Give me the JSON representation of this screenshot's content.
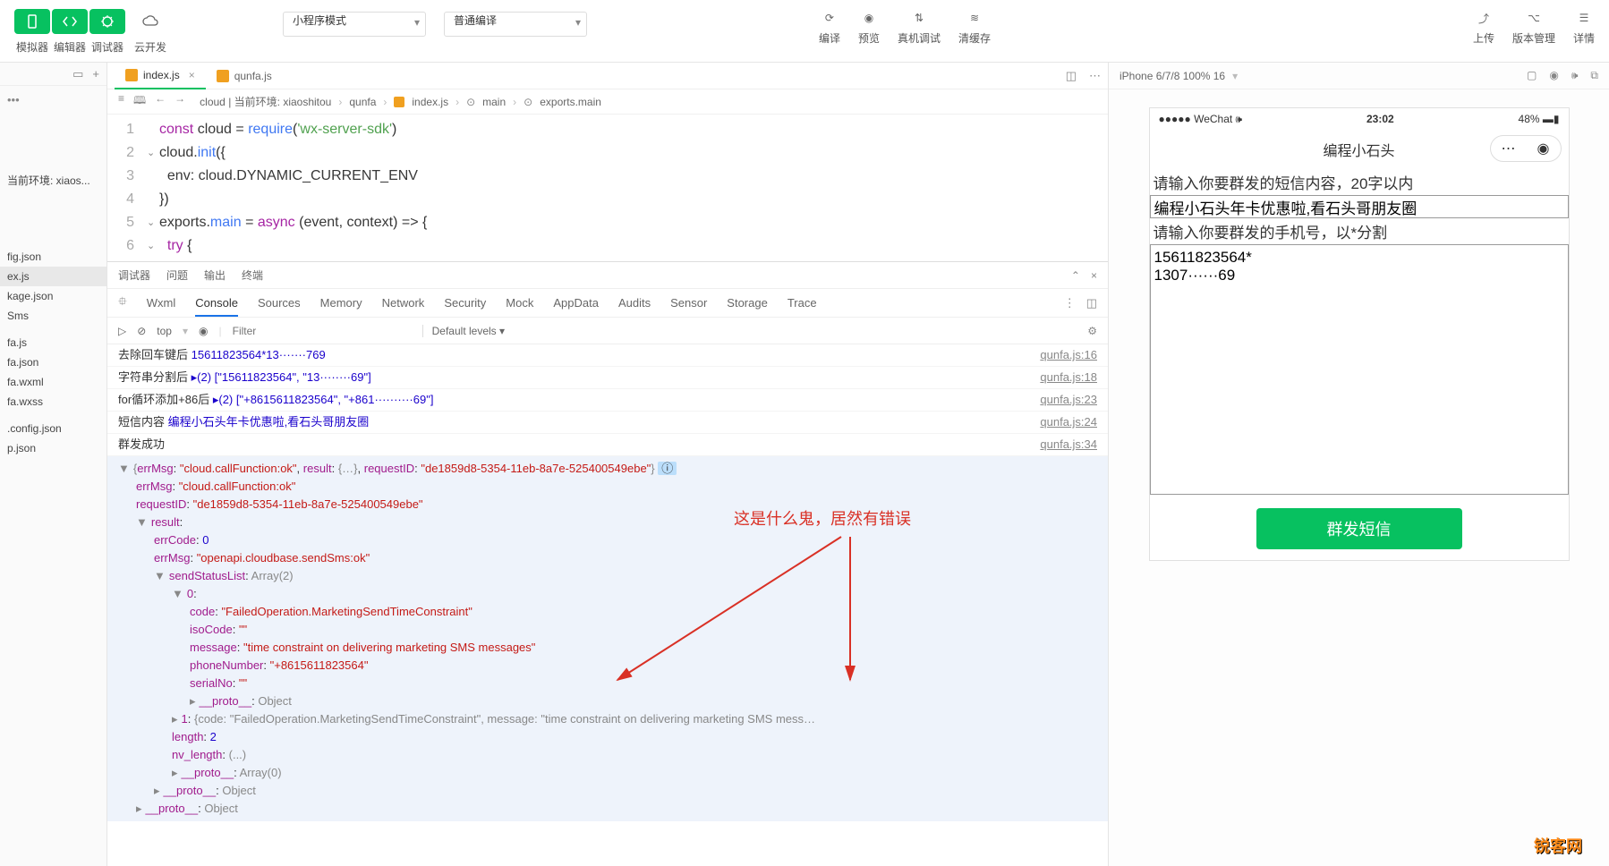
{
  "toolbar": {
    "simulator": "模拟器",
    "editor": "编辑器",
    "debugger": "调试器",
    "cloud": "云开发",
    "mode_select": "小程序模式",
    "compile_select": "普通编译",
    "compile": "编译",
    "preview": "预览",
    "remote_debug": "真机调试",
    "clear_cache": "清缓存",
    "upload": "上传",
    "version": "版本管理",
    "details": "详情"
  },
  "sidebar": {
    "env": "当前环境: xiaos...",
    "files": [
      "fig.json",
      "ex.js",
      "kage.json",
      "Sms",
      "",
      "fa.js",
      "fa.json",
      "fa.wxml",
      "fa.wxss",
      "",
      ".config.json",
      "p.json"
    ]
  },
  "tabs": {
    "active": "index.js",
    "other": "qunfa.js"
  },
  "breadcrumb": {
    "parts": [
      "cloud | 当前环境: xiaoshitou",
      "qunfa",
      "index.js",
      "main",
      "exports.main"
    ]
  },
  "code": {
    "lines": [
      "const cloud = require('wx-server-sdk')",
      "cloud.init({",
      "  env: cloud.DYNAMIC_CURRENT_ENV",
      "})",
      "exports.main = async (event, context) => {",
      "  try {"
    ]
  },
  "devtools": {
    "tabs": [
      "调试器",
      "问题",
      "输出",
      "终端"
    ],
    "subtabs": [
      "Wxml",
      "Console",
      "Sources",
      "Memory",
      "Network",
      "Security",
      "Mock",
      "AppData",
      "Audits",
      "Sensor",
      "Storage",
      "Trace"
    ],
    "filter_context": "top",
    "filter_placeholder": "Filter",
    "levels": "Default levels ▾"
  },
  "console": {
    "logs": [
      {
        "msg_prefix": "去除回车键后 ",
        "msg_value": "15611823564*13·······769",
        "src": "qunfa.js:16"
      },
      {
        "msg_prefix": "字符串分割后 ",
        "msg_value": "▸(2) [\"15611823564\", \"13········69\"]",
        "src": "qunfa.js:18"
      },
      {
        "msg_prefix": "for循环添加+86后 ",
        "msg_value": "▸(2) [\"+8615611823564\", \"+861··········69\"]",
        "src": "qunfa.js:23"
      },
      {
        "msg_prefix": "短信内容 ",
        "msg_value": "编程小石头年卡优惠啦,看石头哥朋友圈",
        "src": "qunfa.js:24"
      },
      {
        "msg_prefix": "群发成功",
        "msg_value": "",
        "src": "qunfa.js:34"
      }
    ],
    "result": {
      "top": "{errMsg: \"cloud.callFunction:ok\", result: {…}, requestID: \"de1859d8-5354-11eb-8a7e-525400549ebe\"}",
      "errMsg": "\"cloud.callFunction:ok\"",
      "requestID": "\"de1859d8-5354-11eb-8a7e-525400549ebe\"",
      "result_errCode": "0",
      "result_errMsg": "\"openapi.cloudbase.sendSms:ok\"",
      "sendStatusList": "Array(2)",
      "item0_code": "\"FailedOperation.MarketingSendTimeConstraint\"",
      "item0_isoCode": "\"\"",
      "item0_message": "\"time constraint on delivering marketing SMS messages\"",
      "item0_phone": "\"+8615611823564\"",
      "item0_serial": "\"\"",
      "item0_proto": "Object",
      "item1": "{code: \"FailedOperation.MarketingSendTimeConstraint\", message: \"time constraint on delivering marketing SMS mess…",
      "length": "2",
      "nv_length": "(...)",
      "proto_arr": "Array(0)",
      "proto_obj": "Object"
    },
    "annotation": "这是什么鬼，居然有错误"
  },
  "simulator": {
    "device": "iPhone 6/7/8 100% 16",
    "carrier": "WeChat",
    "time": "23:02",
    "battery": "48%",
    "title": "编程小石头",
    "label1": "请输入你要群发的短信内容，20字以内",
    "input1": "编程小石头年卡优惠啦,看石头哥朋友圈",
    "label2": "请输入你要群发的手机号，以*分割",
    "textarea": "15611823564*\n1307······69",
    "button": "群发短信"
  },
  "watermark": "锐客网"
}
